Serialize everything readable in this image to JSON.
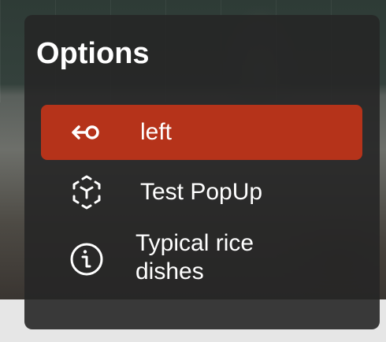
{
  "panel": {
    "title": "Options",
    "items": [
      {
        "label": "left",
        "icon": "back-arrow-circle-icon",
        "selected": true
      },
      {
        "label": "Test PopUp",
        "icon": "ar-cube-icon",
        "selected": false
      },
      {
        "label": "Typical rice dishes",
        "icon": "info-circle-icon",
        "selected": false
      }
    ]
  },
  "colors": {
    "selected_background": "#b5331a",
    "panel_background": "#262626",
    "text": "#ffffff"
  }
}
